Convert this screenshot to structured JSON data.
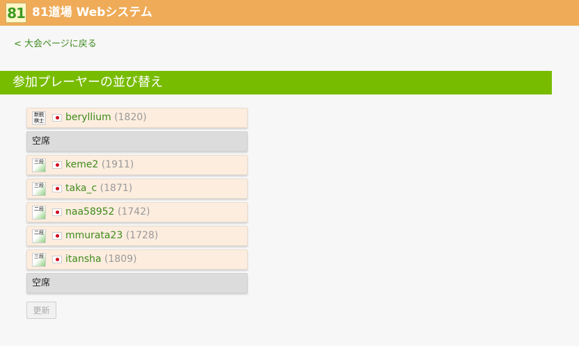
{
  "header": {
    "logo_text": "81",
    "title": "81道場 Webシステム"
  },
  "back_link": "< 大会ページに戻る",
  "section": {
    "title": "参加プレーヤーの並び替え"
  },
  "players": [
    {
      "type": "player",
      "rank_icon": "新鋭棋士",
      "name": "beryllium",
      "rating": "(1820)"
    },
    {
      "type": "empty",
      "label": "空席"
    },
    {
      "type": "player",
      "rank_icon": "三段",
      "name": "keme2",
      "rating": "(1911)"
    },
    {
      "type": "player",
      "rank_icon": "三段",
      "name": "taka_c",
      "rating": "(1871)"
    },
    {
      "type": "player",
      "rank_icon": "二段",
      "name": "naa58952",
      "rating": "(1742)"
    },
    {
      "type": "player",
      "rank_icon": "二段",
      "name": "mmurata23",
      "rating": "(1728)"
    },
    {
      "type": "player",
      "rank_icon": "三段",
      "name": "itansha",
      "rating": "(1809)"
    },
    {
      "type": "empty",
      "label": "空席"
    }
  ],
  "update_button": "更新",
  "colors": {
    "header_bg": "#efab58",
    "section_bg": "#78bc00",
    "link": "#3e8a1c",
    "row_bg": "#fdeddf",
    "empty_bg": "#dcdcdc"
  }
}
